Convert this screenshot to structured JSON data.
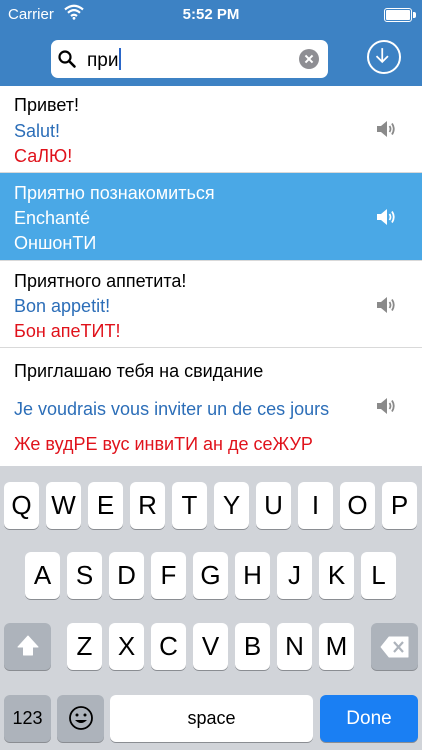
{
  "status": {
    "carrier": "Carrier",
    "time": "5:52 PM"
  },
  "search": {
    "query": "при"
  },
  "colors": {
    "header": "#3d82c4",
    "selected_row": "#4aa8e6",
    "french": "#2c6eb8",
    "phonetic": "#e0121b",
    "done_key": "#1a7ff3"
  },
  "phrases": [
    {
      "russian": "Привет!",
      "french": "Salut!",
      "phonetic": "СаЛЮ!",
      "selected": false
    },
    {
      "russian": "Приятно познакомиться",
      "french": "Enchanté",
      "phonetic": "ОншонТИ",
      "selected": true
    },
    {
      "russian": "Приятного аппетита!",
      "french": "Bon appetit!",
      "phonetic": "Бон апеТИТ!",
      "selected": false
    },
    {
      "russian": "Приглашаю тебя на свидание",
      "french": "Je voudrais vous inviter un de ces jours",
      "phonetic": "Же вудРЕ вус инвиТИ ан де сеЖУР",
      "selected": false
    }
  ],
  "keyboard": {
    "row1": [
      "Q",
      "W",
      "E",
      "R",
      "T",
      "Y",
      "U",
      "I",
      "O",
      "P"
    ],
    "row2": [
      "A",
      "S",
      "D",
      "F",
      "G",
      "H",
      "J",
      "K",
      "L"
    ],
    "row3": [
      "Z",
      "X",
      "C",
      "V",
      "B",
      "N",
      "M"
    ],
    "numbers_label": "123",
    "space_label": "space",
    "done_label": "Done"
  }
}
